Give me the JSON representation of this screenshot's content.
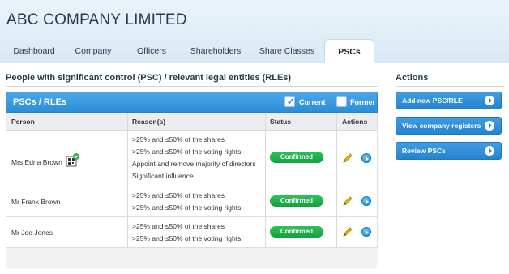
{
  "company_name": "ABC COMPANY LIMITED",
  "tabs": [
    {
      "label": "Dashboard"
    },
    {
      "label": "Company"
    },
    {
      "label": "Officers"
    },
    {
      "label": "Shareholders"
    },
    {
      "label": "Share Classes"
    },
    {
      "label": "PSCs",
      "active": true
    }
  ],
  "section_title": "People with significant control (PSC) / relevant legal entities (RLEs)",
  "panel": {
    "title": "PSCs / RLEs",
    "filters": {
      "current": "Current",
      "current_checked": true,
      "former": "Former",
      "former_checked": false
    }
  },
  "table": {
    "headers": {
      "person": "Person",
      "reasons": "Reason(s)",
      "status": "Status",
      "actions": "Actions"
    },
    "rows": [
      {
        "person": "Mrs Edna Brown",
        "verified": true,
        "reasons": [
          ">25% and ≤50% of the shares",
          ">25% and ≤50% of the voting rights",
          "Appoint and remove majority of directors",
          "Significant influence"
        ],
        "status": "Confirmed"
      },
      {
        "person": "Mr Frank Brown",
        "verified": false,
        "reasons": [
          ">25% and ≤50% of the shares",
          ">25% and ≤50% of the voting rights"
        ],
        "status": "Confirmed"
      },
      {
        "person": "Mr Joe Jones",
        "verified": false,
        "reasons": [
          ">25% and ≤50% of the shares",
          ">25% and ≤50% of the voting rights"
        ],
        "status": "Confirmed"
      }
    ]
  },
  "actions": {
    "title": "Actions",
    "buttons": [
      {
        "label": "Add new PSC/RLE"
      },
      {
        "label": "View company registers"
      },
      {
        "label": "Review PSCs"
      }
    ]
  },
  "colors": {
    "accent": "#2d8ed6",
    "status_green": "#14a140"
  },
  "icons": {
    "edit": "pencil-icon",
    "go": "arrow-right-circle-icon",
    "qr": "qr-code-icon",
    "verified": "check-badge-icon"
  }
}
